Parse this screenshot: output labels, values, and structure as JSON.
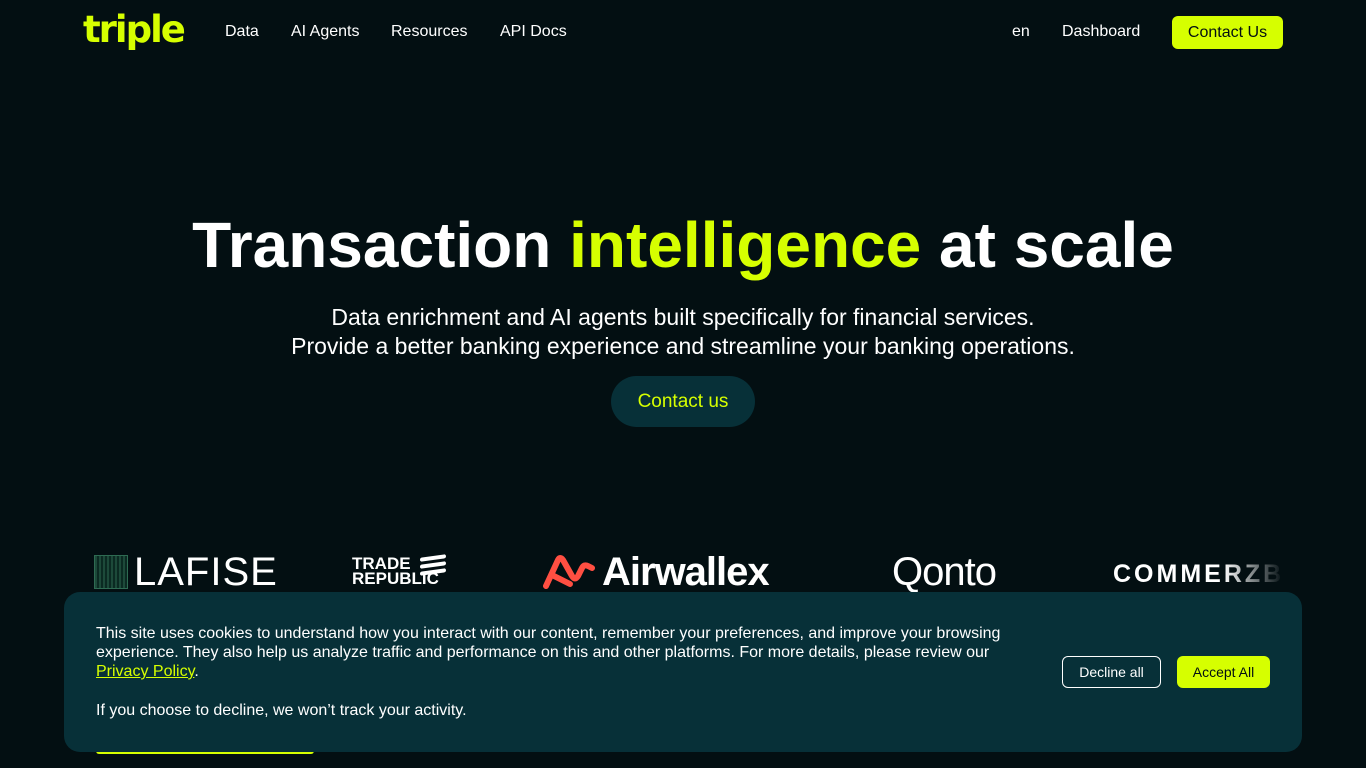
{
  "header": {
    "logo": "triple",
    "nav": [
      "Data",
      "AI Agents",
      "Resources",
      "API Docs"
    ],
    "language": "en",
    "dashboard": "Dashboard",
    "contact": "Contact Us"
  },
  "hero": {
    "title_start": "Transaction ",
    "title_accent": "intelligence",
    "title_end": " at scale",
    "subtitle_line1": "Data enrichment and AI agents built specifically for financial services.",
    "subtitle_line2": "Provide a better banking experience and streamline your banking operations.",
    "cta": "Contact us"
  },
  "logos": {
    "lafise": "LAFISE",
    "trade_line1": "TRADE",
    "trade_line2": "REPUBLIC",
    "airwallex": "Airwallex",
    "qonto": "Qonto",
    "commerz": "COMMERZBANK"
  },
  "cookie": {
    "text": "This site uses cookies to understand how you interact with our content, remember your preferences, and improve your browsing experience. They also help us analyze traffic and performance on this and other platforms. For more details, please review our ",
    "link": "Privacy Policy",
    "after_link": ".",
    "decline_note": "If you choose to decline, we won’t track your activity.",
    "decline": "Decline all",
    "accept": "Accept All"
  },
  "colors": {
    "background": "#030f12",
    "accent": "#d6ff00",
    "panel": "#073038",
    "airwallex_mark": "#ff4f42"
  }
}
